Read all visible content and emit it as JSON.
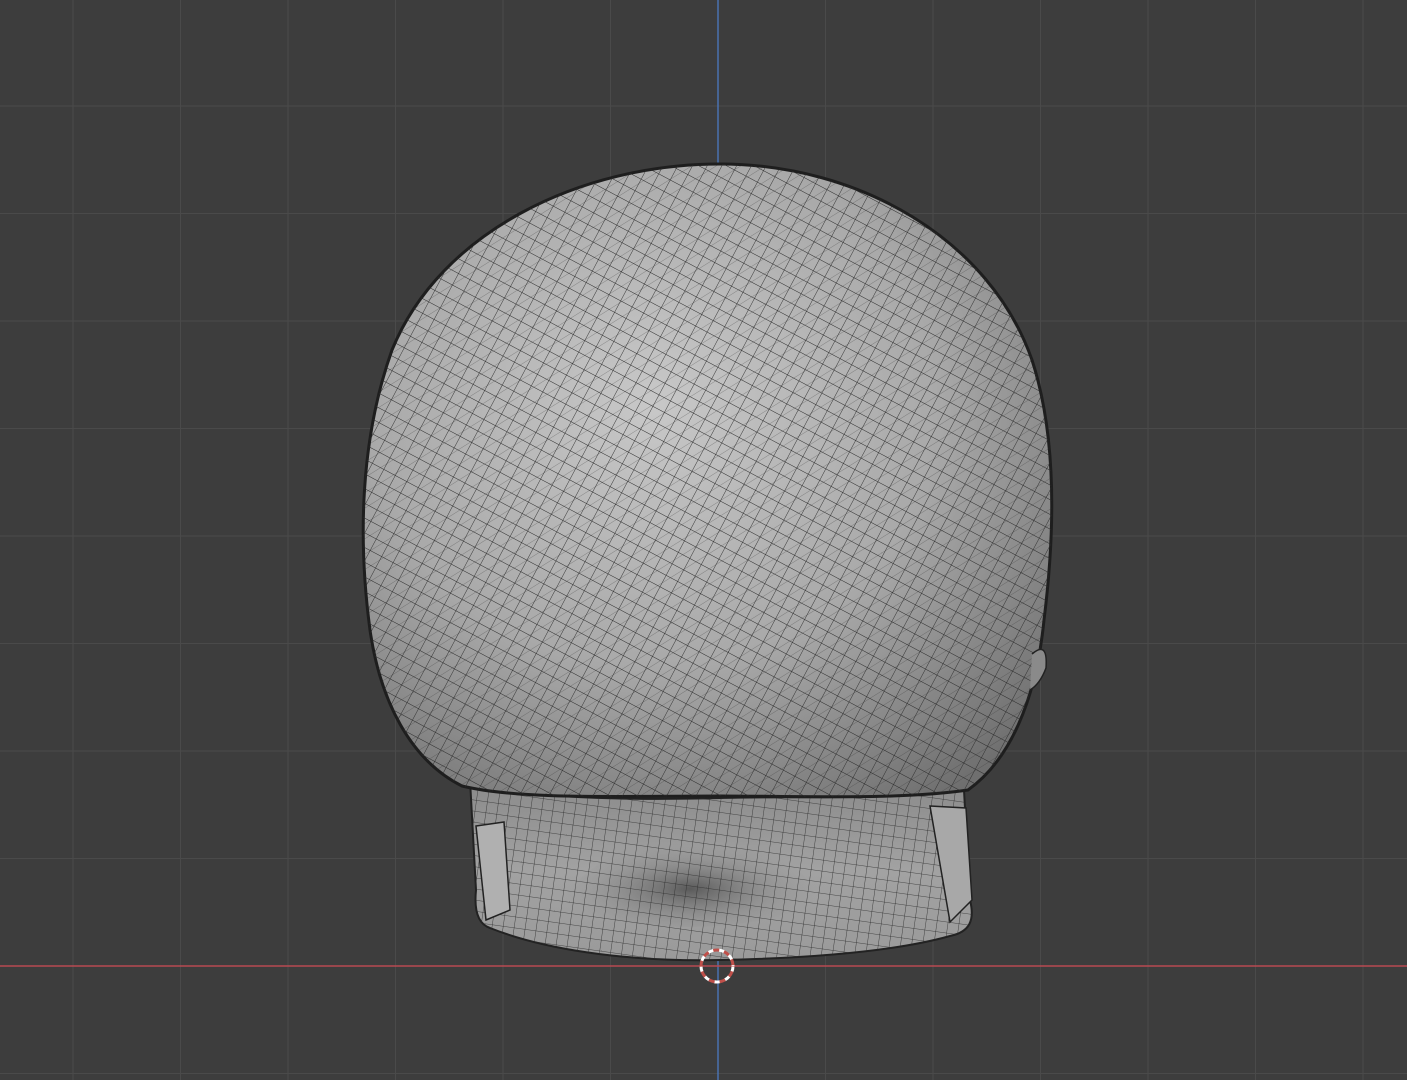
{
  "viewport": {
    "view": "3d-viewport",
    "object": "head-mesh",
    "shading": "solid-wireframe-overlay",
    "background_color": "#3d3d3d",
    "grid_color": "#4a4a4a",
    "grid_major_color": "#505050",
    "x_axis_color": "#b84a52",
    "z_axis_color": "#4a72b0",
    "cursor_color": "#c0504a",
    "cursor_icon": "3d-cursor-icon"
  }
}
